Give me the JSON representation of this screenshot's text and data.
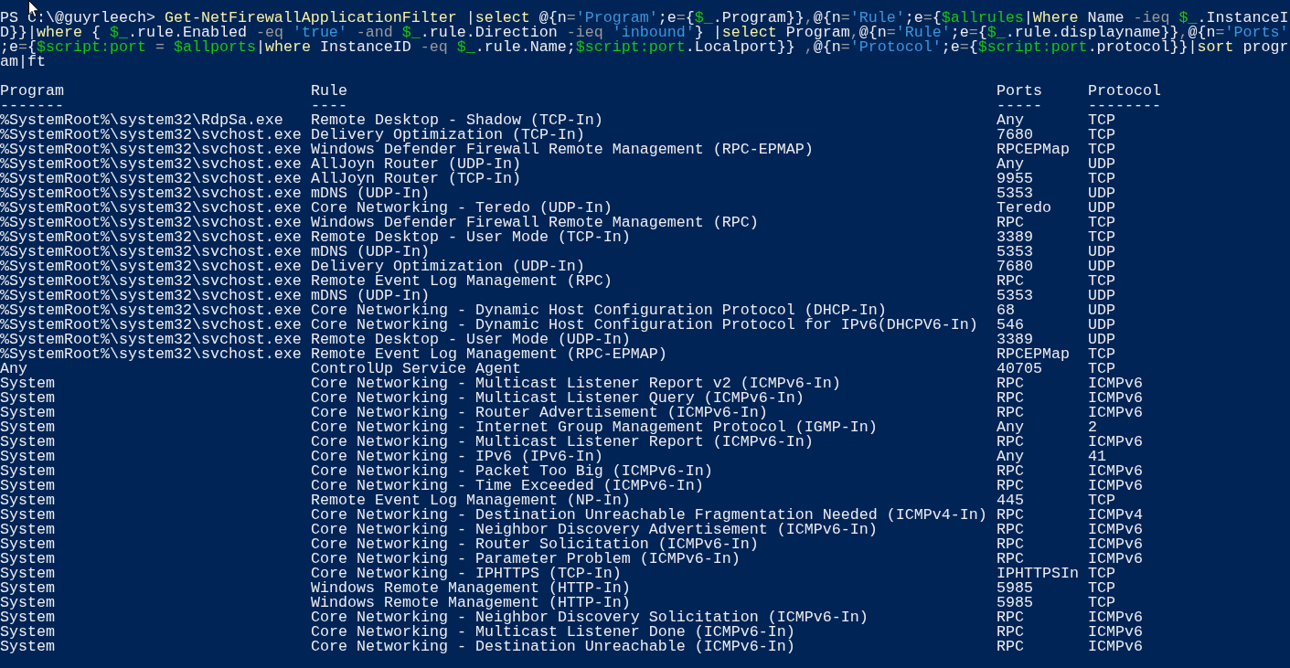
{
  "command_lines": [
    [
      {
        "kind": "plain",
        "text": "PS C:\\@guyrleech> "
      },
      {
        "kind": "command",
        "text": "Get-NetFirewallApplicationFilter"
      },
      {
        "kind": "plain",
        "text": " |"
      },
      {
        "kind": "command",
        "text": "select"
      },
      {
        "kind": "plain",
        "text": " @{n"
      },
      {
        "kind": "operator",
        "text": "="
      },
      {
        "kind": "string",
        "text": "'Program'"
      },
      {
        "kind": "plain",
        "text": ";e"
      },
      {
        "kind": "operator",
        "text": "="
      },
      {
        "kind": "plain",
        "text": "{"
      },
      {
        "kind": "variable",
        "text": "$_"
      },
      {
        "kind": "plain",
        "text": ".Program}}"
      },
      {
        "kind": "operator",
        "text": ","
      },
      {
        "kind": "plain",
        "text": "@{n"
      },
      {
        "kind": "operator",
        "text": "="
      },
      {
        "kind": "string",
        "text": "'Rule'"
      },
      {
        "kind": "plain",
        "text": ";e"
      },
      {
        "kind": "operator",
        "text": "="
      },
      {
        "kind": "plain",
        "text": "{"
      },
      {
        "kind": "variable",
        "text": "$allrules"
      },
      {
        "kind": "plain",
        "text": "|"
      },
      {
        "kind": "command",
        "text": "Where"
      },
      {
        "kind": "plain",
        "text": " Name "
      },
      {
        "kind": "operator",
        "text": "-ieq "
      },
      {
        "kind": "variable",
        "text": "$_"
      },
      {
        "kind": "plain",
        "text": ".InstanceI"
      }
    ],
    [
      {
        "kind": "plain",
        "text": "D}}|"
      },
      {
        "kind": "command",
        "text": "where"
      },
      {
        "kind": "plain",
        "text": " { "
      },
      {
        "kind": "variable",
        "text": "$_"
      },
      {
        "kind": "plain",
        "text": ".rule.Enabled "
      },
      {
        "kind": "operator",
        "text": "-eq "
      },
      {
        "kind": "string",
        "text": "'true'"
      },
      {
        "kind": "operator",
        "text": " -and "
      },
      {
        "kind": "variable",
        "text": "$_"
      },
      {
        "kind": "plain",
        "text": ".rule.Direction "
      },
      {
        "kind": "operator",
        "text": "-ieq "
      },
      {
        "kind": "string",
        "text": "'inbound'"
      },
      {
        "kind": "plain",
        "text": "} |"
      },
      {
        "kind": "command",
        "text": "select"
      },
      {
        "kind": "plain",
        "text": " Program"
      },
      {
        "kind": "operator",
        "text": ","
      },
      {
        "kind": "plain",
        "text": "@{n"
      },
      {
        "kind": "operator",
        "text": "="
      },
      {
        "kind": "string",
        "text": "'Rule'"
      },
      {
        "kind": "plain",
        "text": ";e"
      },
      {
        "kind": "operator",
        "text": "="
      },
      {
        "kind": "plain",
        "text": "{"
      },
      {
        "kind": "variable",
        "text": "$_"
      },
      {
        "kind": "plain",
        "text": ".rule.displayname}}"
      },
      {
        "kind": "operator",
        "text": ","
      },
      {
        "kind": "plain",
        "text": "@{n"
      },
      {
        "kind": "operator",
        "text": "="
      },
      {
        "kind": "string",
        "text": "'Ports'"
      }
    ],
    [
      {
        "kind": "plain",
        "text": ";e"
      },
      {
        "kind": "operator",
        "text": "="
      },
      {
        "kind": "plain",
        "text": "{"
      },
      {
        "kind": "variable",
        "text": "$script:port"
      },
      {
        "kind": "operator",
        "text": " = "
      },
      {
        "kind": "variable",
        "text": "$allports"
      },
      {
        "kind": "plain",
        "text": "|"
      },
      {
        "kind": "command",
        "text": "where"
      },
      {
        "kind": "plain",
        "text": " InstanceID "
      },
      {
        "kind": "operator",
        "text": "-eq "
      },
      {
        "kind": "variable",
        "text": "$_"
      },
      {
        "kind": "plain",
        "text": ".rule.Name;"
      },
      {
        "kind": "variable",
        "text": "$script:port"
      },
      {
        "kind": "plain",
        "text": ".Localport}} "
      },
      {
        "kind": "operator",
        "text": ","
      },
      {
        "kind": "plain",
        "text": "@{n"
      },
      {
        "kind": "operator",
        "text": "="
      },
      {
        "kind": "string",
        "text": "'Protocol'"
      },
      {
        "kind": "plain",
        "text": ";e"
      },
      {
        "kind": "operator",
        "text": "="
      },
      {
        "kind": "plain",
        "text": "{"
      },
      {
        "kind": "variable",
        "text": "$script:port"
      },
      {
        "kind": "plain",
        "text": ".protocol}}|"
      },
      {
        "kind": "command",
        "text": "sort"
      },
      {
        "kind": "plain",
        "text": " progr"
      }
    ],
    [
      {
        "kind": "plain",
        "text": "am|ft"
      }
    ]
  ],
  "table": {
    "columns": [
      {
        "title": "Program",
        "underline": "-------"
      },
      {
        "title": "Rule",
        "underline": "----"
      },
      {
        "title": "Ports",
        "underline": "-----"
      },
      {
        "title": "Protocol",
        "underline": "--------"
      }
    ],
    "rows": [
      [
        "%SystemRoot%\\system32\\RdpSa.exe",
        "Remote Desktop - Shadow (TCP-In)",
        "Any",
        "TCP"
      ],
      [
        "%SystemRoot%\\system32\\svchost.exe",
        "Delivery Optimization (TCP-In)",
        "7680",
        "TCP"
      ],
      [
        "%SystemRoot%\\system32\\svchost.exe",
        "Windows Defender Firewall Remote Management (RPC-EPMAP)",
        "RPCEPMap",
        "TCP"
      ],
      [
        "%SystemRoot%\\system32\\svchost.exe",
        "AllJoyn Router (UDP-In)",
        "Any",
        "UDP"
      ],
      [
        "%SystemRoot%\\system32\\svchost.exe",
        "AllJoyn Router (TCP-In)",
        "9955",
        "TCP"
      ],
      [
        "%SystemRoot%\\system32\\svchost.exe",
        "mDNS (UDP-In)",
        "5353",
        "UDP"
      ],
      [
        "%SystemRoot%\\system32\\svchost.exe",
        "Core Networking - Teredo (UDP-In)",
        "Teredo",
        "UDP"
      ],
      [
        "%SystemRoot%\\system32\\svchost.exe",
        "Windows Defender Firewall Remote Management (RPC)",
        "RPC",
        "TCP"
      ],
      [
        "%SystemRoot%\\system32\\svchost.exe",
        "Remote Desktop - User Mode (TCP-In)",
        "3389",
        "TCP"
      ],
      [
        "%SystemRoot%\\system32\\svchost.exe",
        "mDNS (UDP-In)",
        "5353",
        "UDP"
      ],
      [
        "%SystemRoot%\\system32\\svchost.exe",
        "Delivery Optimization (UDP-In)",
        "7680",
        "UDP"
      ],
      [
        "%SystemRoot%\\system32\\svchost.exe",
        "Remote Event Log Management (RPC)",
        "RPC",
        "TCP"
      ],
      [
        "%SystemRoot%\\system32\\svchost.exe",
        "mDNS (UDP-In)",
        "5353",
        "UDP"
      ],
      [
        "%SystemRoot%\\system32\\svchost.exe",
        "Core Networking - Dynamic Host Configuration Protocol (DHCP-In)",
        "68",
        "UDP"
      ],
      [
        "%SystemRoot%\\system32\\svchost.exe",
        "Core Networking - Dynamic Host Configuration Protocol for IPv6(DHCPV6-In)",
        "546",
        "UDP"
      ],
      [
        "%SystemRoot%\\system32\\svchost.exe",
        "Remote Desktop - User Mode (UDP-In)",
        "3389",
        "UDP"
      ],
      [
        "%SystemRoot%\\system32\\svchost.exe",
        "Remote Event Log Management (RPC-EPMAP)",
        "RPCEPMap",
        "TCP"
      ],
      [
        "Any",
        "ControlUp Service Agent",
        "40705",
        "TCP"
      ],
      [
        "System",
        "Core Networking - Multicast Listener Report v2 (ICMPv6-In)",
        "RPC",
        "ICMPv6"
      ],
      [
        "System",
        "Core Networking - Multicast Listener Query (ICMPv6-In)",
        "RPC",
        "ICMPv6"
      ],
      [
        "System",
        "Core Networking - Router Advertisement (ICMPv6-In)",
        "RPC",
        "ICMPv6"
      ],
      [
        "System",
        "Core Networking - Internet Group Management Protocol (IGMP-In)",
        "Any",
        "2"
      ],
      [
        "System",
        "Core Networking - Multicast Listener Report (ICMPv6-In)",
        "RPC",
        "ICMPv6"
      ],
      [
        "System",
        "Core Networking - IPv6 (IPv6-In)",
        "Any",
        "41"
      ],
      [
        "System",
        "Core Networking - Packet Too Big (ICMPv6-In)",
        "RPC",
        "ICMPv6"
      ],
      [
        "System",
        "Core Networking - Time Exceeded (ICMPv6-In)",
        "RPC",
        "ICMPv6"
      ],
      [
        "System",
        "Remote Event Log Management (NP-In)",
        "445",
        "TCP"
      ],
      [
        "System",
        "Core Networking - Destination Unreachable Fragmentation Needed (ICMPv4-In)",
        "RPC",
        "ICMPv4"
      ],
      [
        "System",
        "Core Networking - Neighbor Discovery Advertisement (ICMPv6-In)",
        "RPC",
        "ICMPv6"
      ],
      [
        "System",
        "Core Networking - Router Solicitation (ICMPv6-In)",
        "RPC",
        "ICMPv6"
      ],
      [
        "System",
        "Core Networking - Parameter Problem (ICMPv6-In)",
        "RPC",
        "ICMPv6"
      ],
      [
        "System",
        "Core Networking - IPHTTPS (TCP-In)",
        "IPHTTPSIn",
        "TCP"
      ],
      [
        "System",
        "Windows Remote Management (HTTP-In)",
        "5985",
        "TCP"
      ],
      [
        "System",
        "Windows Remote Management (HTTP-In)",
        "5985",
        "TCP"
      ],
      [
        "System",
        "Core Networking - Neighbor Discovery Solicitation (ICMPv6-In)",
        "RPC",
        "ICMPv6"
      ],
      [
        "System",
        "Core Networking - Multicast Listener Done (ICMPv6-In)",
        "RPC",
        "ICMPv6"
      ],
      [
        "System",
        "Core Networking - Destination Unreachable (ICMPv6-In)",
        "RPC",
        "ICMPv6"
      ]
    ]
  }
}
